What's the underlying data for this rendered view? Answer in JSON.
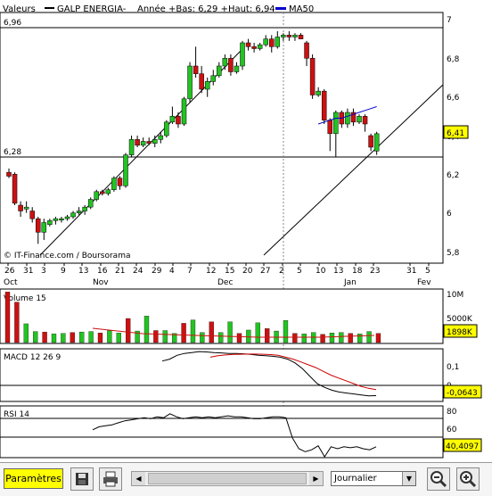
{
  "header": {
    "valeurs_label": "Valeurs",
    "stock_name": "GALP ENERGIA-",
    "range_text": "Année +Bas: 6,29 +Haut: 6,94",
    "ma_legend": "MA50"
  },
  "price_panel": {
    "y_ticks": [
      "7",
      "6,8",
      "6,6",
      "6,4",
      "6,2",
      "6",
      "5,8"
    ],
    "level_high": "6,96",
    "level_low": "6,28",
    "last_price": "6,41",
    "copyright": "© IT-Finance.com / Boursorama"
  },
  "date_axis": {
    "days": [
      "26",
      "31",
      "3",
      "9",
      "13",
      "16",
      "21",
      "24",
      "29",
      "4",
      "7",
      "12",
      "15",
      "20",
      "27",
      "2",
      "5",
      "10",
      "13",
      "18",
      "23",
      "31",
      "5"
    ],
    "months": [
      "Oct",
      "Nov",
      "Dec",
      "Jan",
      "Fev"
    ]
  },
  "volume_panel": {
    "label": "Volume 15",
    "ticks": [
      "10M",
      "5000K"
    ],
    "last_value": "1898K"
  },
  "macd_panel": {
    "label": "MACD 12 26 9",
    "ticks": [
      "0,1",
      "0"
    ],
    "last_value": "-0,0643"
  },
  "rsi_panel": {
    "label": "RSI 14",
    "ticks": [
      "80",
      "60"
    ],
    "last_value": "40,4097"
  },
  "toolbar": {
    "params_label": "Paramètres",
    "period_value": "Journalier"
  },
  "colors": {
    "up": "#22c322",
    "down": "#cc1111",
    "ma": "#0000cc",
    "signal": "#cc0000",
    "last_value_bg": "#ffff00"
  },
  "chart_data": {
    "type": "candlestick",
    "candles": [
      {
        "o": 6.21,
        "h": 6.23,
        "l": 6.18,
        "c": 6.19
      },
      {
        "o": 6.2,
        "h": 6.21,
        "l": 6.04,
        "c": 6.05
      },
      {
        "o": 6.04,
        "h": 6.06,
        "l": 5.98,
        "c": 6.01
      },
      {
        "o": 6.02,
        "h": 6.06,
        "l": 6.0,
        "c": 6.03
      },
      {
        "o": 6.01,
        "h": 6.03,
        "l": 5.95,
        "c": 5.97
      },
      {
        "o": 5.97,
        "h": 5.98,
        "l": 5.84,
        "c": 5.9
      },
      {
        "o": 5.9,
        "h": 5.97,
        "l": 5.86,
        "c": 5.95
      },
      {
        "o": 5.94,
        "h": 5.97,
        "l": 5.93,
        "c": 5.96
      },
      {
        "o": 5.96,
        "h": 5.98,
        "l": 5.94,
        "c": 5.97
      },
      {
        "o": 5.97,
        "h": 5.98,
        "l": 5.95,
        "c": 5.97
      },
      {
        "o": 5.97,
        "h": 5.99,
        "l": 5.96,
        "c": 5.98
      },
      {
        "o": 5.98,
        "h": 6.01,
        "l": 5.97,
        "c": 6.0
      },
      {
        "o": 6.0,
        "h": 6.03,
        "l": 5.99,
        "c": 6.01
      },
      {
        "o": 6.01,
        "h": 6.04,
        "l": 5.99,
        "c": 6.03
      },
      {
        "o": 6.03,
        "h": 6.08,
        "l": 6.02,
        "c": 6.07
      },
      {
        "o": 6.07,
        "h": 6.12,
        "l": 6.06,
        "c": 6.11
      },
      {
        "o": 6.11,
        "h": 6.12,
        "l": 6.09,
        "c": 6.1
      },
      {
        "o": 6.1,
        "h": 6.13,
        "l": 6.09,
        "c": 6.12
      },
      {
        "o": 6.12,
        "h": 6.19,
        "l": 6.11,
        "c": 6.18
      },
      {
        "o": 6.18,
        "h": 6.19,
        "l": 6.12,
        "c": 6.14
      },
      {
        "o": 6.14,
        "h": 6.31,
        "l": 6.13,
        "c": 6.3
      },
      {
        "o": 6.3,
        "h": 6.4,
        "l": 6.29,
        "c": 6.38
      },
      {
        "o": 6.38,
        "h": 6.4,
        "l": 6.34,
        "c": 6.35
      },
      {
        "o": 6.35,
        "h": 6.39,
        "l": 6.34,
        "c": 6.37
      },
      {
        "o": 6.37,
        "h": 6.39,
        "l": 6.35,
        "c": 6.36
      },
      {
        "o": 6.36,
        "h": 6.4,
        "l": 6.34,
        "c": 6.38
      },
      {
        "o": 6.38,
        "h": 6.42,
        "l": 6.36,
        "c": 6.4
      },
      {
        "o": 6.4,
        "h": 6.48,
        "l": 6.39,
        "c": 6.47
      },
      {
        "o": 6.47,
        "h": 6.55,
        "l": 6.46,
        "c": 6.5
      },
      {
        "o": 6.5,
        "h": 6.52,
        "l": 6.44,
        "c": 6.46
      },
      {
        "o": 6.46,
        "h": 6.6,
        "l": 6.45,
        "c": 6.59
      },
      {
        "o": 6.59,
        "h": 6.78,
        "l": 6.57,
        "c": 6.76
      },
      {
        "o": 6.76,
        "h": 6.86,
        "l": 6.7,
        "c": 6.72
      },
      {
        "o": 6.72,
        "h": 6.76,
        "l": 6.62,
        "c": 6.64
      },
      {
        "o": 6.64,
        "h": 6.7,
        "l": 6.6,
        "c": 6.68
      },
      {
        "o": 6.68,
        "h": 6.74,
        "l": 6.66,
        "c": 6.71
      },
      {
        "o": 6.71,
        "h": 6.78,
        "l": 6.7,
        "c": 6.76
      },
      {
        "o": 6.76,
        "h": 6.82,
        "l": 6.74,
        "c": 6.8
      },
      {
        "o": 6.8,
        "h": 6.82,
        "l": 6.71,
        "c": 6.73
      },
      {
        "o": 6.73,
        "h": 6.78,
        "l": 6.72,
        "c": 6.76
      },
      {
        "o": 6.76,
        "h": 6.89,
        "l": 6.74,
        "c": 6.88
      },
      {
        "o": 6.88,
        "h": 6.9,
        "l": 6.84,
        "c": 6.86
      },
      {
        "o": 6.86,
        "h": 6.88,
        "l": 6.83,
        "c": 6.85
      },
      {
        "o": 6.85,
        "h": 6.88,
        "l": 6.84,
        "c": 6.87
      },
      {
        "o": 6.87,
        "h": 6.92,
        "l": 6.86,
        "c": 6.9
      },
      {
        "o": 6.9,
        "h": 6.92,
        "l": 6.83,
        "c": 6.86
      },
      {
        "o": 6.86,
        "h": 6.94,
        "l": 6.85,
        "c": 6.91
      },
      {
        "o": 6.91,
        "h": 6.93,
        "l": 6.89,
        "c": 6.92
      },
      {
        "o": 6.92,
        "h": 6.94,
        "l": 6.89,
        "c": 6.91
      },
      {
        "o": 6.91,
        "h": 6.93,
        "l": 6.89,
        "c": 6.92
      },
      {
        "o": 6.92,
        "h": 6.93,
        "l": 6.9,
        "c": 6.9
      },
      {
        "o": 6.88,
        "h": 6.89,
        "l": 6.76,
        "c": 6.8
      },
      {
        "o": 6.8,
        "h": 6.82,
        "l": 6.59,
        "c": 6.61
      },
      {
        "o": 6.61,
        "h": 6.65,
        "l": 6.6,
        "c": 6.63
      },
      {
        "o": 6.63,
        "h": 6.64,
        "l": 6.46,
        "c": 6.48
      },
      {
        "o": 6.48,
        "h": 6.49,
        "l": 6.32,
        "c": 6.41
      },
      {
        "o": 6.41,
        "h": 6.53,
        "l": 6.29,
        "c": 6.52
      },
      {
        "o": 6.52,
        "h": 6.53,
        "l": 6.44,
        "c": 6.46
      },
      {
        "o": 6.46,
        "h": 6.54,
        "l": 6.44,
        "c": 6.52
      },
      {
        "o": 6.52,
        "h": 6.54,
        "l": 6.45,
        "c": 6.47
      },
      {
        "o": 6.47,
        "h": 6.51,
        "l": 6.46,
        "c": 6.5
      },
      {
        "o": 6.5,
        "h": 6.51,
        "l": 6.42,
        "c": 6.46
      },
      {
        "o": 6.4,
        "h": 6.41,
        "l": 6.32,
        "c": 6.34
      },
      {
        "o": 6.32,
        "h": 6.42,
        "l": 6.3,
        "c": 6.41
      }
    ],
    "ma50": [
      6.46,
      6.47,
      6.48,
      6.49,
      6.49,
      6.5,
      6.51,
      6.52,
      6.53,
      6.54,
      6.55
    ],
    "volume": [
      10.5,
      8.4,
      3.9,
      2.3,
      2.2,
      1.8,
      1.9,
      2.1,
      2.2,
      2.3,
      2.0,
      2.5,
      2.0,
      5.0,
      2.4,
      5.5,
      2.5,
      2.5,
      1.9,
      4.0,
      4.7,
      2.1,
      4.3,
      2.1,
      4.3,
      1.9,
      2.6,
      4.1,
      2.9,
      2.4,
      4.6,
      1.9,
      1.8,
      2.1,
      1.7,
      2.0,
      2.1,
      1.9,
      1.8,
      2.3,
      1.9
    ],
    "rsi_ylim": [
      40,
      90
    ],
    "rsi": [
      67,
      70,
      71,
      72,
      74,
      76,
      77,
      78,
      79,
      78,
      80,
      79,
      83,
      80,
      78,
      79,
      80,
      79,
      80,
      79,
      80,
      81,
      80,
      80,
      79,
      78,
      78,
      79,
      80,
      80,
      79,
      59,
      48,
      45,
      47,
      51,
      40,
      50,
      48,
      50,
      49,
      50,
      48,
      47,
      50
    ],
    "macd_ylim": [
      -0.09,
      0.18
    ],
    "macd": [
      0.12,
      0.13,
      0.15,
      0.16,
      0.165,
      0.17,
      0.168,
      0.165,
      0.163,
      0.16,
      0.16,
      0.158,
      0.155,
      0.15,
      0.148,
      0.145,
      0.14,
      0.13,
      0.11,
      0.08,
      0.04,
      0.0,
      -0.02,
      -0.035,
      -0.045,
      -0.05,
      -0.055,
      -0.06,
      -0.065,
      -0.064
    ],
    "signal": [
      0.14,
      0.148,
      0.152,
      0.155,
      0.156,
      0.157,
      0.157,
      0.156,
      0.154,
      0.15,
      0.14,
      0.13,
      0.115,
      0.1,
      0.085,
      0.065,
      0.045,
      0.03,
      0.015,
      0.0,
      -0.015,
      -0.025,
      -0.032
    ]
  }
}
